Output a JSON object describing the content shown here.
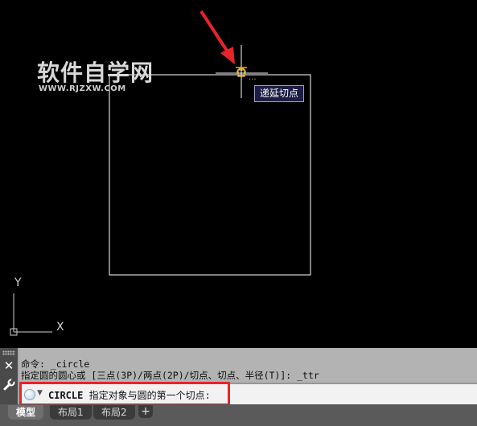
{
  "watermark": {
    "title": "软件自学网",
    "url": "WWW.RJZXW.COM"
  },
  "snap_tooltip": "递延切点",
  "ucs": {
    "y_label": "Y",
    "x_label": "X"
  },
  "command_history": [
    "命令: _circle",
    "指定圆的圆心或 [三点(3P)/两点(2P)/切点、切点、半径(T)]: _ttr"
  ],
  "command_line": {
    "command": "CIRCLE",
    "prompt": "指定对象与圆的第一个切点:"
  },
  "tabs": [
    {
      "label": "模型",
      "active": true
    },
    {
      "label": "布局1",
      "active": false
    },
    {
      "label": "布局2",
      "active": false
    }
  ],
  "add_tab_label": "+",
  "colors": {
    "background": "#000000",
    "drawing_lines": "#ffffff",
    "snap_marker": "#f0b400",
    "annotation_arrow": "#e8242a",
    "highlight_box": "#e8242a"
  },
  "icons": {
    "close": "close-icon",
    "wrench": "wrench-icon",
    "prompt": "command-prompt-icon",
    "ucs": "ucs-icon"
  }
}
